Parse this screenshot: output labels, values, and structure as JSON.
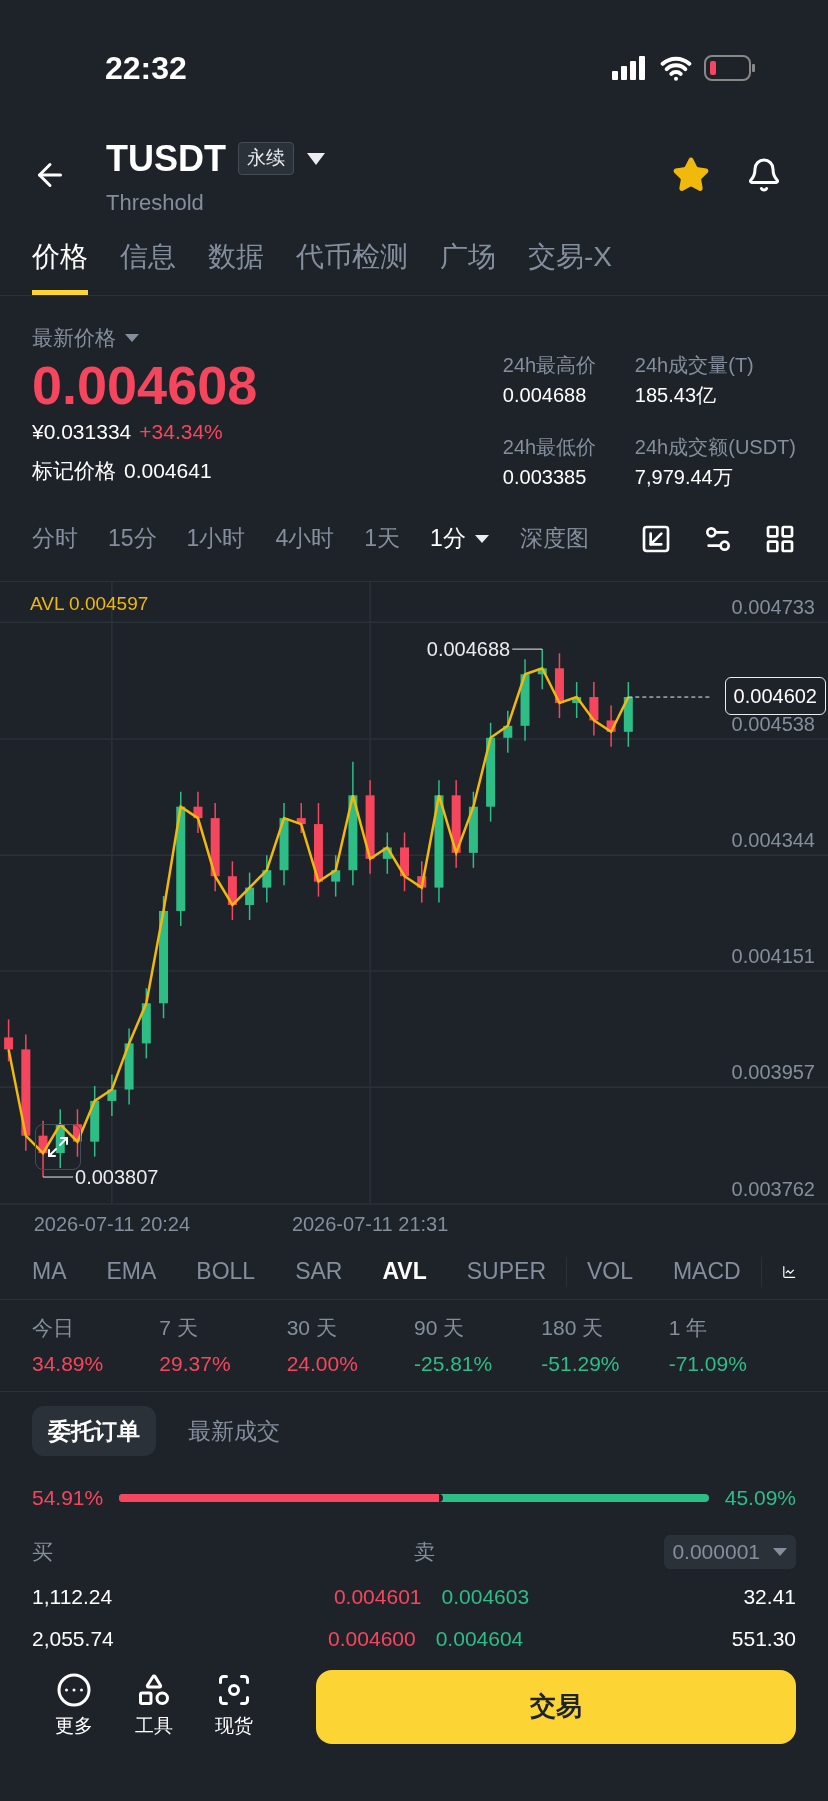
{
  "status_bar": {
    "time": "22:32"
  },
  "header": {
    "symbol": "TUSDT",
    "badge": "永续",
    "subtitle": "Threshold",
    "favorite": true
  },
  "tabs": [
    {
      "label": "价格",
      "selected": true
    },
    {
      "label": "信息",
      "selected": false
    },
    {
      "label": "数据",
      "selected": false
    },
    {
      "label": "代币检测",
      "selected": false
    },
    {
      "label": "广场",
      "selected": false
    },
    {
      "label": "交易-X",
      "selected": false
    }
  ],
  "price": {
    "label": "最新价格",
    "last": "0.004608",
    "cny": "¥0.031334",
    "change": "+34.34%",
    "mark_label": "标记价格",
    "mark": "0.004641",
    "stats": [
      {
        "label": "24h最高价",
        "value": "0.004688"
      },
      {
        "label": "24h成交量(T)",
        "value": "185.43亿"
      },
      {
        "label": "24h最低价",
        "value": "0.003385"
      },
      {
        "label": "24h成交额(USDT)",
        "value": "7,979.44万"
      }
    ]
  },
  "intervals": [
    {
      "label": "分时",
      "selected": false,
      "dropdown": false
    },
    {
      "label": "15分",
      "selected": false,
      "dropdown": false
    },
    {
      "label": "1小时",
      "selected": false,
      "dropdown": false
    },
    {
      "label": "4小时",
      "selected": false,
      "dropdown": false
    },
    {
      "label": "1天",
      "selected": false,
      "dropdown": false
    },
    {
      "label": "1分",
      "selected": true,
      "dropdown": true
    },
    {
      "label": "深度图",
      "selected": false,
      "dropdown": false
    }
  ],
  "chart": {
    "legend_value": "0.004597",
    "last_price": "0.004602",
    "chart_data": {
      "type": "candlestick",
      "categories": [
        null,
        null,
        null,
        null,
        null,
        null,
        "2026-07-11 20:24",
        null,
        null,
        null,
        null,
        null,
        null,
        null,
        null,
        null,
        null,
        null,
        null,
        null,
        null,
        "2026-07-11 21:31",
        null,
        null,
        null,
        null,
        null,
        null,
        null,
        null,
        null,
        null,
        null,
        null,
        null,
        null,
        null
      ],
      "ohlc": [
        [
          0.00404,
          0.00407,
          0.004,
          0.00402
        ],
        [
          0.00402,
          0.004045,
          0.003851,
          0.003876
        ],
        [
          0.003876,
          0.003901,
          0.003807,
          0.003847
        ],
        [
          0.003847,
          0.00392,
          0.003822,
          0.003895
        ],
        [
          0.003895,
          0.00392,
          0.003841,
          0.003866
        ],
        [
          0.003866,
          0.003959,
          0.003841,
          0.003934
        ],
        [
          0.003934,
          0.003978,
          0.003909,
          0.003953
        ],
        [
          0.003953,
          0.004055,
          0.003928,
          0.00403
        ],
        [
          0.00403,
          0.004122,
          0.004005,
          0.004097
        ],
        [
          0.004097,
          0.004276,
          0.004072,
          0.004251
        ],
        [
          0.004251,
          0.00445,
          0.004226,
          0.004425
        ],
        [
          0.004425,
          0.00445,
          0.004381,
          0.004406
        ],
        [
          0.004406,
          0.004431,
          0.004284,
          0.004309
        ],
        [
          0.004309,
          0.004334,
          0.004236,
          0.004261
        ],
        [
          0.004261,
          0.004315,
          0.004236,
          0.00429
        ],
        [
          0.00429,
          0.004344,
          0.004265,
          0.004319
        ],
        [
          0.004319,
          0.004431,
          0.004294,
          0.004406
        ],
        [
          0.004406,
          0.004431,
          0.004381,
          0.004396
        ],
        [
          0.004396,
          0.004431,
          0.004275,
          0.0043
        ],
        [
          0.0043,
          0.004344,
          0.004275,
          0.004319
        ],
        [
          0.004319,
          0.0045,
          0.004294,
          0.004444
        ],
        [
          0.004444,
          0.004469,
          0.004313,
          0.004338
        ],
        [
          0.004338,
          0.004382,
          0.004313,
          0.004357
        ],
        [
          0.004357,
          0.004382,
          0.004284,
          0.004309
        ],
        [
          0.004309,
          0.004334,
          0.004265,
          0.00429
        ],
        [
          0.00429,
          0.004469,
          0.004265,
          0.004444
        ],
        [
          0.004444,
          0.004469,
          0.004323,
          0.004348
        ],
        [
          0.004348,
          0.00445,
          0.004323,
          0.004425
        ],
        [
          0.004425,
          0.004565,
          0.0044,
          0.00454
        ],
        [
          0.00454,
          0.004585,
          0.004515,
          0.00456
        ],
        [
          0.00456,
          0.004671,
          0.004535,
          0.004646
        ],
        [
          0.004646,
          0.004688,
          0.004621,
          0.004656
        ],
        [
          0.004656,
          0.004681,
          0.004573,
          0.004598
        ],
        [
          0.004598,
          0.004633,
          0.004573,
          0.004608
        ],
        [
          0.004608,
          0.004633,
          0.004544,
          0.004569
        ],
        [
          0.004569,
          0.004594,
          0.004525,
          0.00455
        ],
        [
          0.00455,
          0.004633,
          0.004525,
          0.004608
        ]
      ],
      "series": [
        {
          "name": "AVL",
          "type": "line",
          "color": "#f0b90b",
          "values": [
            0.00402,
            0.003876,
            0.003847,
            0.003895,
            0.003866,
            0.003934,
            0.003953,
            0.00403,
            0.004097,
            0.004251,
            0.004425,
            0.004406,
            0.004309,
            0.004261,
            0.00429,
            0.004319,
            0.004406,
            0.004396,
            0.0043,
            0.004319,
            0.004444,
            0.004338,
            0.004357,
            0.004309,
            0.00429,
            0.004444,
            0.004348,
            0.004425,
            0.00454,
            0.00456,
            0.004646,
            0.004656,
            0.004598,
            0.004608,
            0.004569,
            0.00455,
            0.004608
          ]
        }
      ],
      "ylim": [
        0.003762,
        0.0048
      ],
      "yticks": [
        0.004733,
        0.004538,
        0.004344,
        0.004151,
        0.003957,
        0.003762
      ],
      "grid": true,
      "annotations": [
        "0.004688",
        "0.003807"
      ]
    }
  },
  "indicators": [
    [
      {
        "label": "MA",
        "selected": false
      },
      {
        "label": "EMA",
        "selected": false
      },
      {
        "label": "BOLL",
        "selected": false
      },
      {
        "label": "SAR",
        "selected": false
      },
      {
        "label": "AVL",
        "selected": true
      },
      {
        "label": "SUPER",
        "selected": false
      }
    ],
    [
      {
        "label": "VOL",
        "selected": false
      },
      {
        "label": "MACD",
        "selected": false
      }
    ]
  ],
  "performance": [
    {
      "label": "今日",
      "value": "34.89%",
      "color": "#f6465d"
    },
    {
      "label": "7 天",
      "value": "29.37%",
      "color": "#f6465d"
    },
    {
      "label": "30 天",
      "value": "24.00%",
      "color": "#f6465d"
    },
    {
      "label": "90 天",
      "value": "-25.81%",
      "color": "#2ebd85"
    },
    {
      "label": "180 天",
      "value": "-51.29%",
      "color": "#2ebd85"
    },
    {
      "label": "1 年",
      "value": "-71.09%",
      "color": "#2ebd85"
    }
  ],
  "order_tabs": [
    {
      "label": "委托订单",
      "selected": true
    },
    {
      "label": "最新成交",
      "selected": false
    }
  ],
  "depth": {
    "buy_pct": "54.91%",
    "sell_pct": "45.09%",
    "level": 0.5491,
    "buy_label": "买",
    "sell_label": "卖",
    "tick": "0.000001",
    "rows": [
      {
        "bid_qty": "1,112.24",
        "bid": "0.004601",
        "ask": "0.004603",
        "ask_qty": "32.41"
      },
      {
        "bid_qty": "2,055.74",
        "bid": "0.004600",
        "ask": "0.004604",
        "ask_qty": "551.30"
      }
    ]
  },
  "bottom": {
    "actions": [
      {
        "label": "更多",
        "kind": "more"
      },
      {
        "label": "工具",
        "kind": "tools"
      },
      {
        "label": "现货",
        "kind": "spot"
      }
    ],
    "trade": "交易"
  }
}
